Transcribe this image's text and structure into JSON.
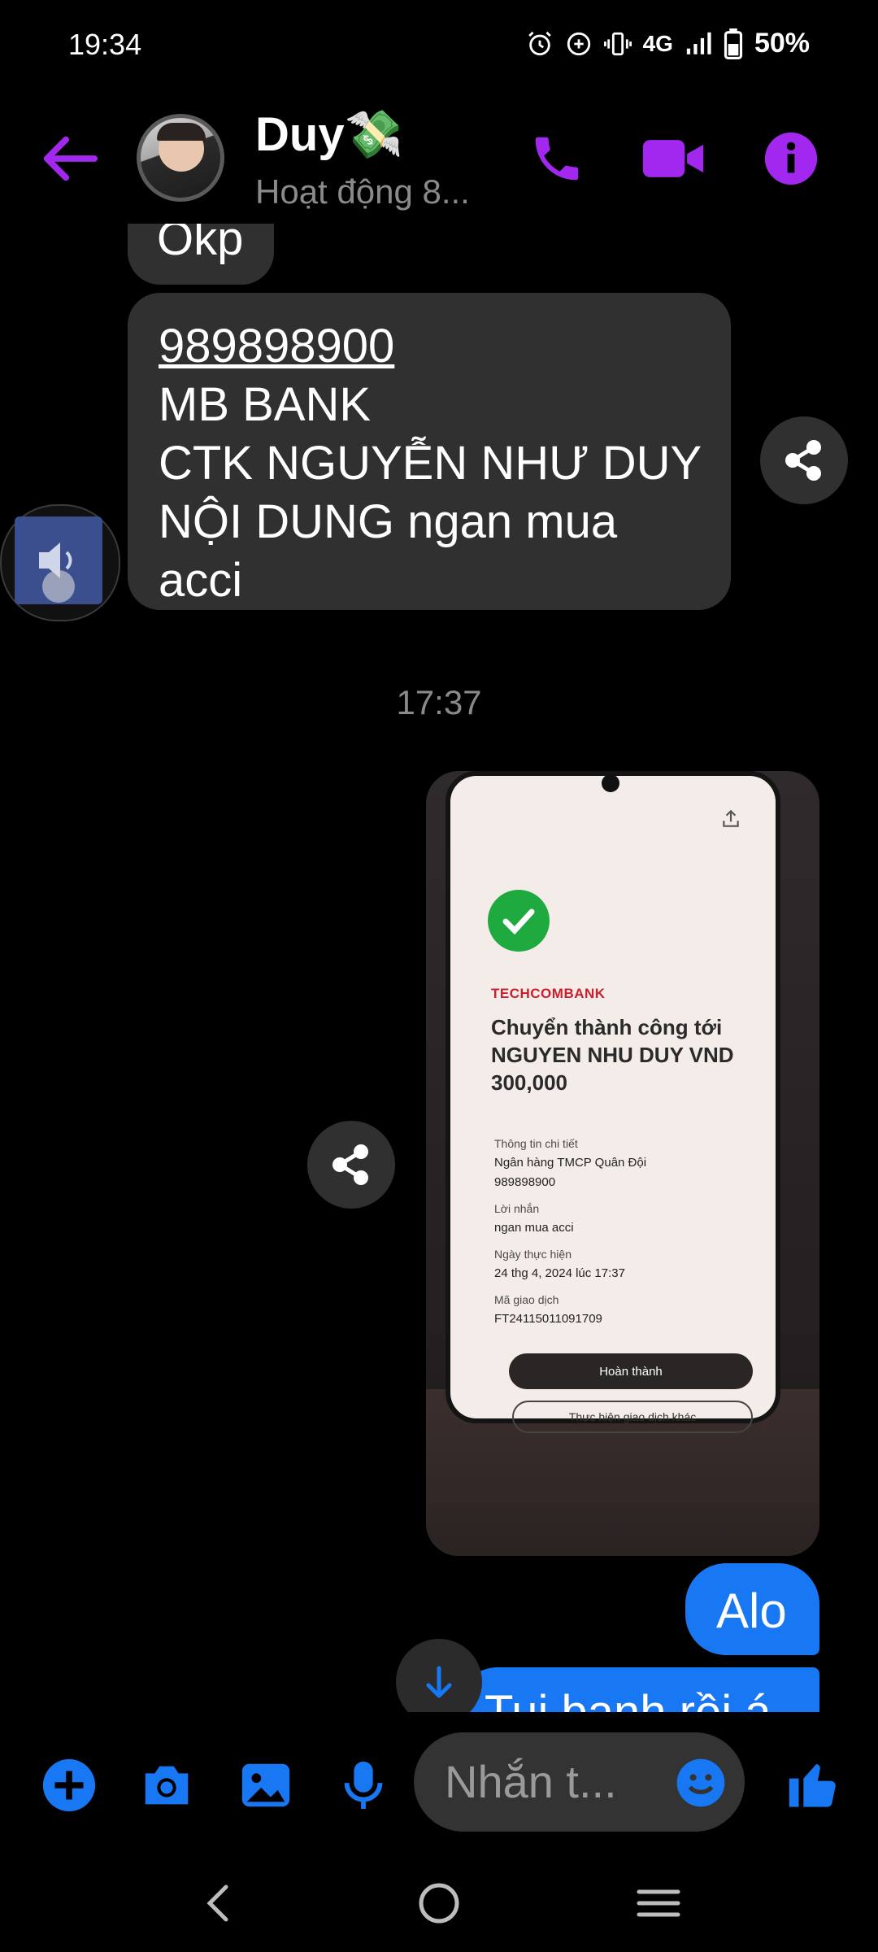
{
  "status_bar": {
    "time": "19:34",
    "network": "4G",
    "battery": "50%",
    "icons": [
      "alarm-icon",
      "data-saver-icon",
      "vibrate-icon",
      "signal-icon",
      "battery-icon"
    ]
  },
  "header": {
    "contact_name": "Duy💸",
    "contact_status": "Hoạt động 8...",
    "icons": [
      "back-arrow-icon",
      "phone-icon",
      "video-icon",
      "info-icon"
    ]
  },
  "colors": {
    "accent_purple": "#a228f0",
    "accent_blue": "#1877f2",
    "incoming_bubble": "#303030",
    "background": "#000000"
  },
  "messages": {
    "okp": "Okp",
    "bank_number": "989898900",
    "bank_line1": "MB BANK",
    "bank_line2": "CTK NGUYỄN NHƯ DUY",
    "bank_line3": "NỘI DUNG ngan mua",
    "bank_line4": "acci",
    "timestamp": "17:37",
    "alo": "Alo",
    "partial": "Tui banh rồi á"
  },
  "photo": {
    "brand": "TECHCOMBANK",
    "title": "Chuyển thành công tới NGUYEN NHU DUY VND 300,000",
    "detail_heading": "Thông tin chi tiết",
    "bank_name": "Ngân hàng TMCP Quân Đội",
    "account": "989898900",
    "note_label": "Lời nhắn",
    "note": "ngan mua acci",
    "date_label": "Ngày thực hiện",
    "date": "24 thg 4, 2024 lúc 17:37",
    "txn_label": "Mã giao dịch",
    "txn": "FT24115011091709",
    "btn_done": "Hoàn thành",
    "btn_other": "Thực hiện giao dịch khác"
  },
  "composer": {
    "placeholder": "Nhắn t...",
    "icons": [
      "add-icon",
      "camera-icon",
      "gallery-icon",
      "mic-icon",
      "emoji-icon",
      "thumbs-up-icon"
    ]
  },
  "nav": {
    "icons": [
      "nav-back-icon",
      "nav-home-icon",
      "nav-menu-icon"
    ]
  }
}
